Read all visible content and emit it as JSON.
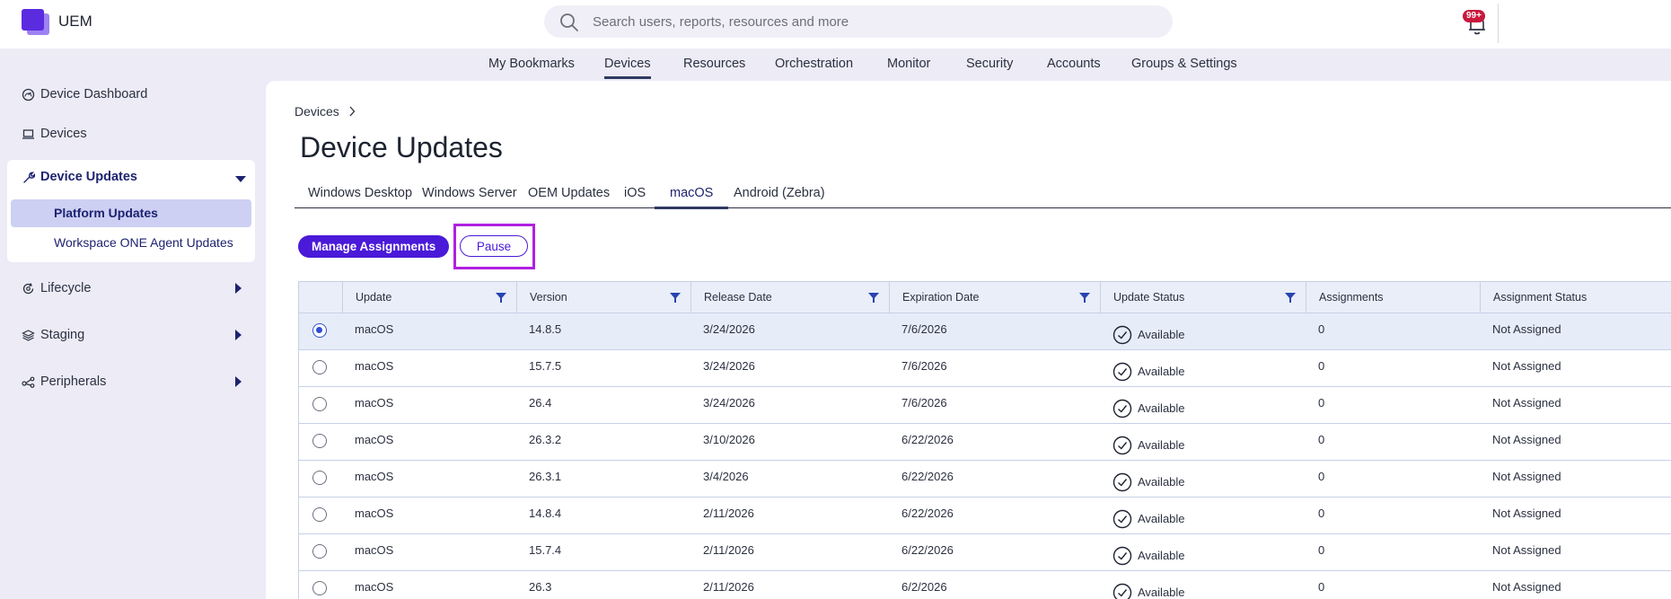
{
  "app": {
    "title": "UEM"
  },
  "search": {
    "placeholder": "Search users, reports, resources and more"
  },
  "notifications": {
    "badge": "99+"
  },
  "mainnav": [
    {
      "label": "My Bookmarks"
    },
    {
      "label": "Devices",
      "active": true
    },
    {
      "label": "Resources"
    },
    {
      "label": "Orchestration"
    },
    {
      "label": "Monitor"
    },
    {
      "label": "Security"
    },
    {
      "label": "Accounts"
    },
    {
      "label": "Groups & Settings"
    }
  ],
  "sidebar": {
    "dashboard": "Device Dashboard",
    "devices": "Devices",
    "updates": {
      "label": "Device Updates",
      "items": [
        {
          "label": "Platform Updates",
          "active": true
        },
        {
          "label": "Workspace ONE Agent Updates"
        }
      ]
    },
    "lifecycle": "Lifecycle",
    "staging": "Staging",
    "peripherals": "Peripherals"
  },
  "breadcrumb": {
    "root": "Devices"
  },
  "page": {
    "title": "Device Updates"
  },
  "tabs": [
    {
      "label": "Windows Desktop"
    },
    {
      "label": "Windows Server"
    },
    {
      "label": "OEM Updates"
    },
    {
      "label": "iOS"
    },
    {
      "label": "macOS",
      "active": true
    },
    {
      "label": "Android (Zebra)"
    }
  ],
  "toolbar": {
    "manage": "Manage Assignments",
    "pause": "Pause"
  },
  "table": {
    "columns": [
      "Update",
      "Version",
      "Release Date",
      "Expiration Date",
      "Update Status",
      "Assignments",
      "Assignment Status"
    ],
    "rows": [
      {
        "update": "macOS",
        "version": "14.8.5",
        "release": "3/24/2026",
        "expiration": "7/6/2026",
        "status": "Available",
        "assignments": "0",
        "assignment_status": "Not Assigned",
        "selected": true
      },
      {
        "update": "macOS",
        "version": "15.7.5",
        "release": "3/24/2026",
        "expiration": "7/6/2026",
        "status": "Available",
        "assignments": "0",
        "assignment_status": "Not Assigned"
      },
      {
        "update": "macOS",
        "version": "26.4",
        "release": "3/24/2026",
        "expiration": "7/6/2026",
        "status": "Available",
        "assignments": "0",
        "assignment_status": "Not Assigned"
      },
      {
        "update": "macOS",
        "version": "26.3.2",
        "release": "3/10/2026",
        "expiration": "6/22/2026",
        "status": "Available",
        "assignments": "0",
        "assignment_status": "Not Assigned"
      },
      {
        "update": "macOS",
        "version": "26.3.1",
        "release": "3/4/2026",
        "expiration": "6/22/2026",
        "status": "Available",
        "assignments": "0",
        "assignment_status": "Not Assigned"
      },
      {
        "update": "macOS",
        "version": "14.8.4",
        "release": "2/11/2026",
        "expiration": "6/22/2026",
        "status": "Available",
        "assignments": "0",
        "assignment_status": "Not Assigned"
      },
      {
        "update": "macOS",
        "version": "15.7.4",
        "release": "2/11/2026",
        "expiration": "6/22/2026",
        "status": "Available",
        "assignments": "0",
        "assignment_status": "Not Assigned"
      },
      {
        "update": "macOS",
        "version": "26.3",
        "release": "2/11/2026",
        "expiration": "6/2/2026",
        "status": "Available",
        "assignments": "0",
        "assignment_status": "Not Assigned"
      }
    ]
  },
  "colors": {
    "accent": "#4a1ad8",
    "nav_text": "#1d2370",
    "highlight_frame": "#b020e0",
    "filter_icon": "#2744b0"
  }
}
